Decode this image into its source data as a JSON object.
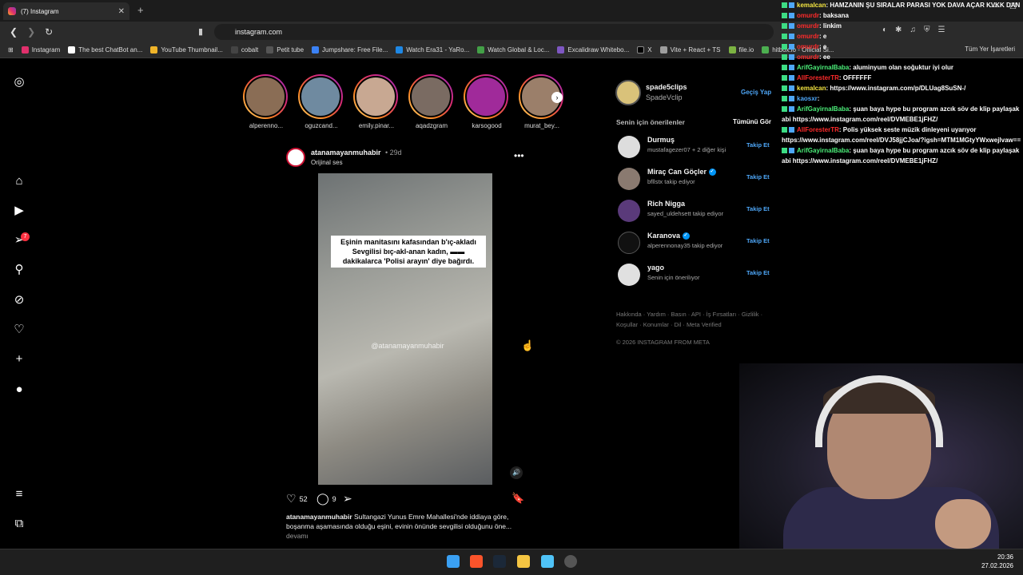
{
  "browser": {
    "tab_title": "(7) Instagram",
    "url": "instagram.com",
    "all_bookmarks": "Tüm Yer İşaretleri"
  },
  "bookmarks": [
    "Instagram",
    "The best ChatBot an...",
    "YouTube Thumbnail...",
    "cobalt",
    "Petit tube",
    "Jumpshare: Free File...",
    "Watch Era31 - YaRo...",
    "Watch Global & Loc...",
    "Excalidraw Whitebo...",
    "X",
    "Vite + React + TS",
    "file.io",
    "hitbox.io - Official Si..."
  ],
  "stories": [
    "alperenno...",
    "oguzcand...",
    "emily.pinar...",
    "aqadzgram",
    "karsogood",
    "murat_bey..."
  ],
  "notifications_badge": "7",
  "post": {
    "username": "atanamayanmuhabir",
    "time": "29d",
    "audio": "Orijinal ses",
    "video_caption": "Eşinin manitasını kafasından b'ıç-akladı Sevgilisi bıç-akl-anan kadın, ▬▬ dakikalarca  'Polisi arayın' diye bağırdı.",
    "watermark": "@atanamayanmuhabir",
    "likes": "52",
    "comments": "9",
    "caption_user": "atanamayanmuhabir",
    "caption_text": "Sultangazi Yunus Emre Mahallesi'nde iddiaya göre, boşanma aşamasında olduğu eşini, evinin önünde sevgilisi olduğunu öne...",
    "more": "devamı"
  },
  "me": {
    "username": "spade5clips",
    "full_name": "SpadeVclip",
    "switch": "Geçiş Yap"
  },
  "suggestions": {
    "title": "Senin için önerilenler",
    "see_all": "Tümünü Gör",
    "follow": "Takip Et",
    "items": [
      {
        "name": "Durmuş",
        "sub": "mustafagezer07 + 2 diğer kişi"
      },
      {
        "name": "Miraç Can Göçler",
        "sub": "bfllstx takip ediyor"
      },
      {
        "name": "Rich Nigga",
        "sub": "sayed_uldehsett takip ediyor"
      },
      {
        "name": "Karanova",
        "sub": "alperennonay35 takip ediyor"
      },
      {
        "name": "yago",
        "sub": "Senin için önerilıyor"
      }
    ]
  },
  "footer": {
    "links": "Hakkında · Yardım · Basın · API · İş Fırsatları · Gizlilik · Koşullar · Konumlar · Dil · Meta Verified",
    "copyright": "© 2026 INSTAGRAM FROM META"
  },
  "chat": [
    {
      "user": "kemalcan",
      "text": ": HAMZANIN ŞU SIRALAR PARASI YOK DAVA AÇAR KVKK DAN",
      "cls": "u-y"
    },
    {
      "user": "omurdr",
      "text": ": baksana",
      "cls": "u-r"
    },
    {
      "user": "omurdr",
      "text": ": linkim",
      "cls": "u-r"
    },
    {
      "user": "omurdr",
      "text": ": e",
      "cls": "u-r"
    },
    {
      "user": "omurdr",
      "text": ": e",
      "cls": "u-r"
    },
    {
      "user": "omurdr",
      "text": ": ee",
      "cls": "u-r"
    },
    {
      "user": "ArifGayirnalBaba",
      "text": ": aluminyum olan soğuktur iyi olur",
      "cls": "u-g"
    },
    {
      "user": "AllForesterTR",
      "text": ": OFFFFFF",
      "cls": "u-r"
    },
    {
      "user": "kemalcan",
      "text": ": https://www.instagram.com/p/DLUag8SuSN-/",
      "cls": "u-y"
    },
    {
      "user": "kaosxr",
      "text": ": ",
      "cls": "u-b"
    },
    {
      "user": "ArifGayirnalBaba",
      "text": ": şuan baya hype bu program azcık söv de klip paylaşak abi https://www.instagram.com/reel/DVMEBE1jFHZ/",
      "cls": "u-g"
    },
    {
      "user": "AllForesterTR",
      "text": ": Polis yüksek seste müzik dinleyeni uyarıyor https://www.instagram.com/reel/DVJ58jjCJoa/?igsh=MTM1MGtyYWxwejlvaw==",
      "cls": "u-r"
    },
    {
      "user": "ArifGayirnalBaba",
      "text": ": şuan baya hype bu program azcık söv de klip paylaşak abi https://www.instagram.com/reel/DVMEBE1jFHZ/",
      "cls": "u-g"
    }
  ],
  "clock": {
    "time": "20:36",
    "date": "27.02.2026"
  }
}
